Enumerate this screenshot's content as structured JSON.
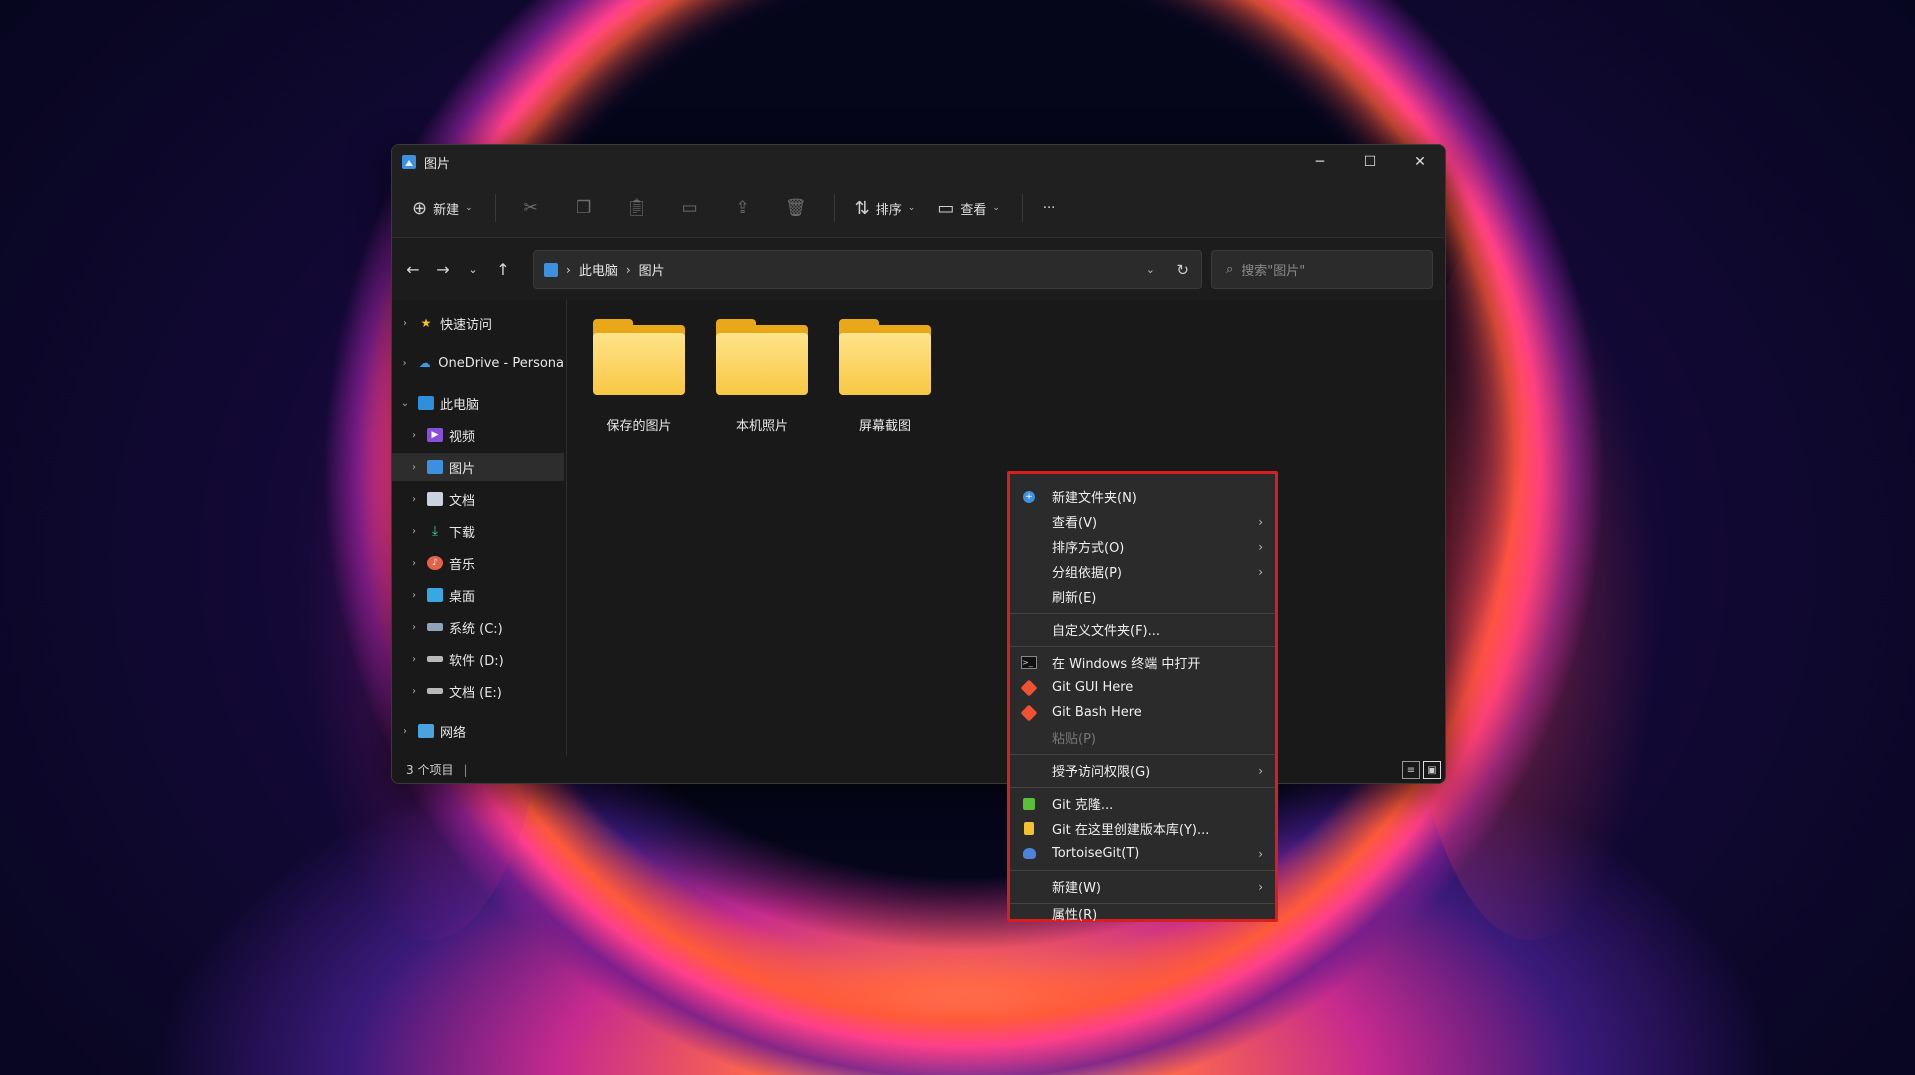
{
  "window": {
    "title": "图片",
    "controls": {
      "minimize": "─",
      "maximize": "☐",
      "close": "✕"
    }
  },
  "toolbar": {
    "new_label": "新建",
    "sort_label": "排序",
    "view_label": "查看",
    "more_label": "···"
  },
  "address": {
    "crumbs": [
      "此电脑",
      "图片"
    ],
    "search_placeholder": "搜索\"图片\""
  },
  "sidebar": {
    "items": [
      {
        "label": "快速访问",
        "icon": "star-icon"
      },
      {
        "label": "OneDrive - Persona",
        "icon": "cloud-icon"
      },
      {
        "label": "此电脑",
        "icon": "computer-icon"
      },
      {
        "label": "视频",
        "icon": "video-icon"
      },
      {
        "label": "图片",
        "icon": "picture-icon"
      },
      {
        "label": "文档",
        "icon": "document-icon"
      },
      {
        "label": "下载",
        "icon": "download-icon"
      },
      {
        "label": "音乐",
        "icon": "music-icon"
      },
      {
        "label": "桌面",
        "icon": "desktop-icon"
      },
      {
        "label": "系统 (C:)",
        "icon": "drive-c-icon"
      },
      {
        "label": "软件 (D:)",
        "icon": "drive-icon"
      },
      {
        "label": "文档 (E:)",
        "icon": "drive-icon"
      },
      {
        "label": "网络",
        "icon": "network-icon"
      }
    ]
  },
  "folders": [
    {
      "name": "保存的图片"
    },
    {
      "name": "本机照片"
    },
    {
      "name": "屏幕截图"
    }
  ],
  "status": {
    "count_text": "3 个项目"
  },
  "context_menu": {
    "items": [
      {
        "label": "新建文件夹(N)",
        "icon": "new-folder-icon"
      },
      {
        "label": "查看(V)"
      },
      {
        "label": "排序方式(O)"
      },
      {
        "label": "分组依据(P)"
      },
      {
        "label": "刷新(E)"
      },
      {
        "label": "自定义文件夹(F)..."
      },
      {
        "label": "在 Windows 终端 中打开",
        "icon": "terminal-icon"
      },
      {
        "label": "Git GUI Here",
        "icon": "git-icon"
      },
      {
        "label": "Git Bash Here",
        "icon": "git-icon"
      },
      {
        "label": "粘贴(P)"
      },
      {
        "label": "授予访问权限(G)"
      },
      {
        "label": "Git 克隆...",
        "icon": "git-clone-icon"
      },
      {
        "label": "Git 在这里创建版本库(Y)...",
        "icon": "git-create-repo-icon"
      },
      {
        "label": "TortoiseGit(T)",
        "icon": "tortoisegit-icon"
      },
      {
        "label": "新建(W)"
      },
      {
        "label": "属性(R)"
      }
    ]
  },
  "colors": {
    "highlight_border": "#d81e1e",
    "folder_yellow": "#f8c743",
    "accent_blue": "#3d8fe0"
  }
}
